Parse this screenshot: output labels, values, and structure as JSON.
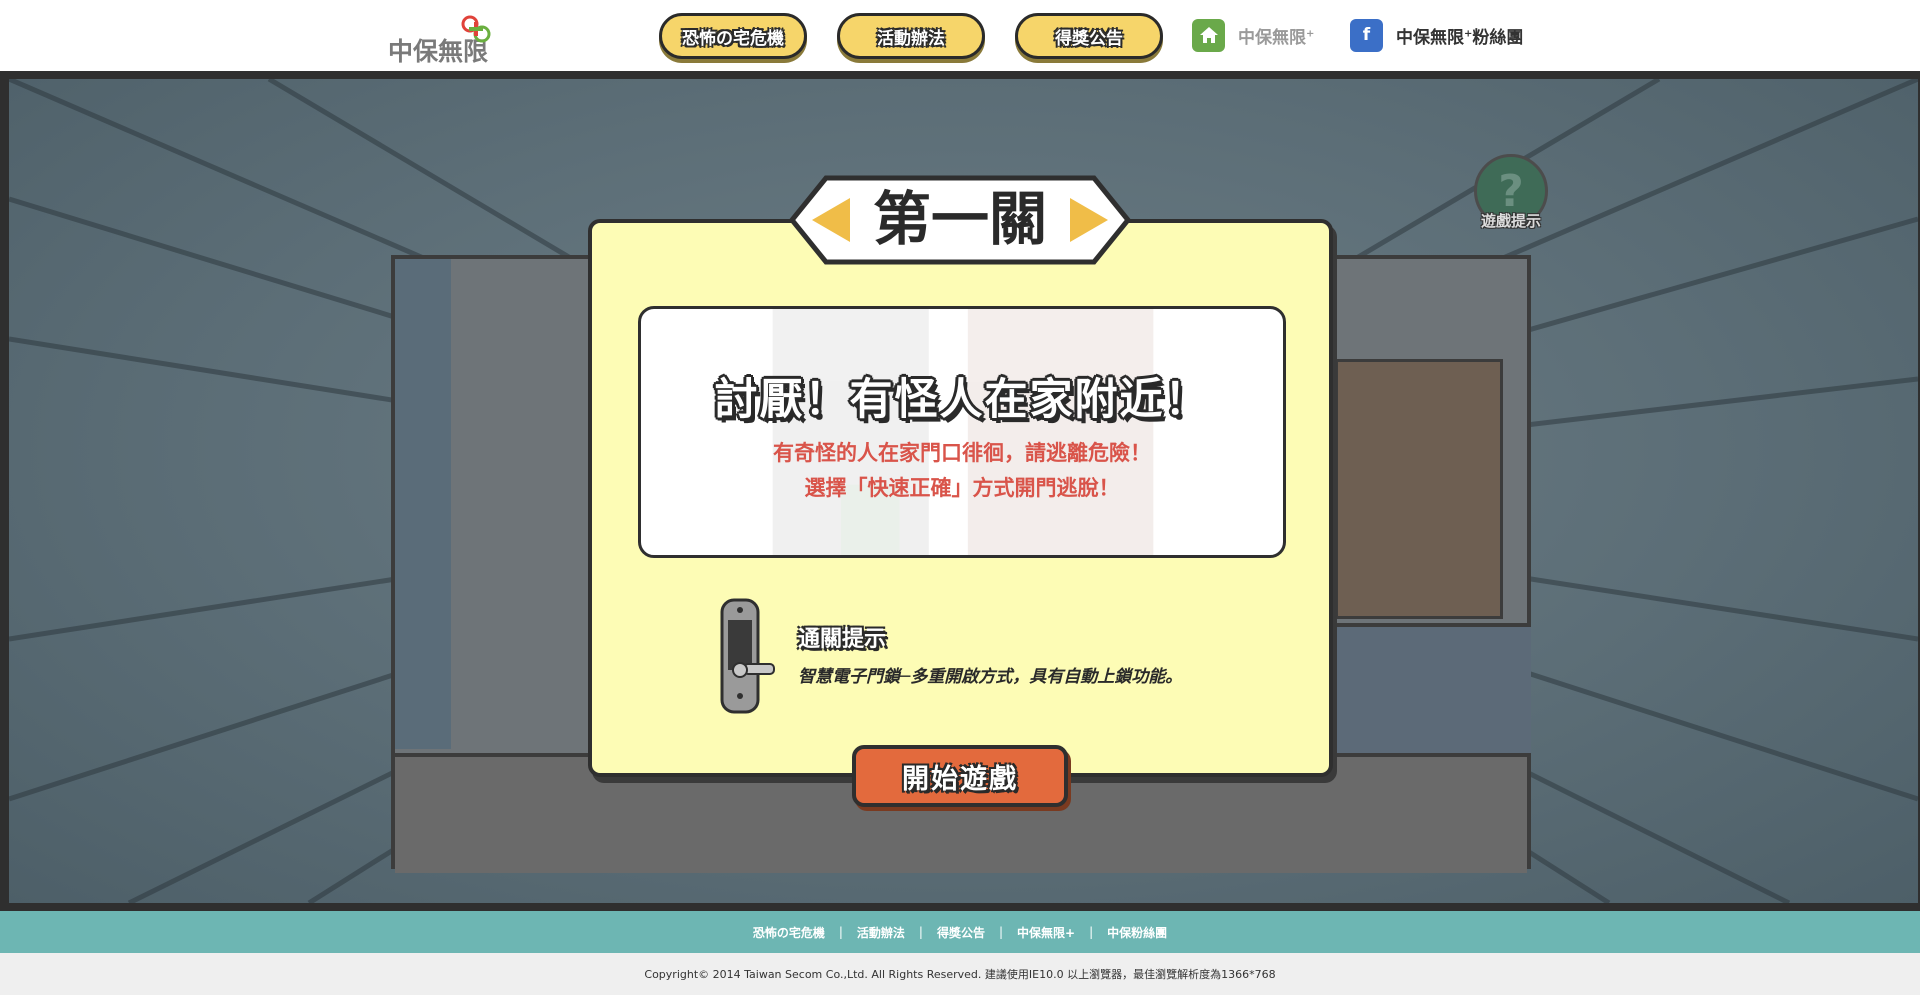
{
  "header": {
    "logo_text": "中保無限",
    "nav": [
      {
        "label": "恐怖の宅危機"
      },
      {
        "label": "活動辦法"
      },
      {
        "label": "得獎公告"
      }
    ],
    "links": {
      "home": {
        "label": "中保無限",
        "sup": "+",
        "icon": "home-icon",
        "color": "#6aa94a"
      },
      "fb": {
        "label": "中保無限",
        "sup": "+",
        "suffix": "粉絲團",
        "icon": "facebook-icon",
        "color": "#3b6fc7"
      }
    }
  },
  "game": {
    "help_label": "遊戲提示",
    "level_title": "第一關",
    "message": {
      "title": "討厭！有怪人在家附近！",
      "line1": "有奇怪的人在家門口徘徊，請逃離危險！",
      "line2": "選擇「快速正確」方式開門逃脫！"
    },
    "hint": {
      "title": "通關提示",
      "text": "智慧電子門鎖─多重開啟方式，具有自動上鎖功能。"
    },
    "start_label": "開始遊戲"
  },
  "footer": {
    "links": [
      "恐怖の宅危機",
      "活動辦法",
      "得獎公告",
      "中保無限+",
      "中保粉絲團"
    ],
    "separator": "|",
    "copyright": "Copyright© 2014 Taiwan Secom Co.,Ltd. All Rights Reserved.  建議使用IE10.0 以上瀏覽器，最佳瀏覽解析度為1366*768"
  },
  "colors": {
    "nav_button": "#f6d56a",
    "dialog_bg": "#fdfcb5",
    "message_text": "#d9544a",
    "start_button": "#e36a3d",
    "footer_bar": "#6db6b3"
  }
}
